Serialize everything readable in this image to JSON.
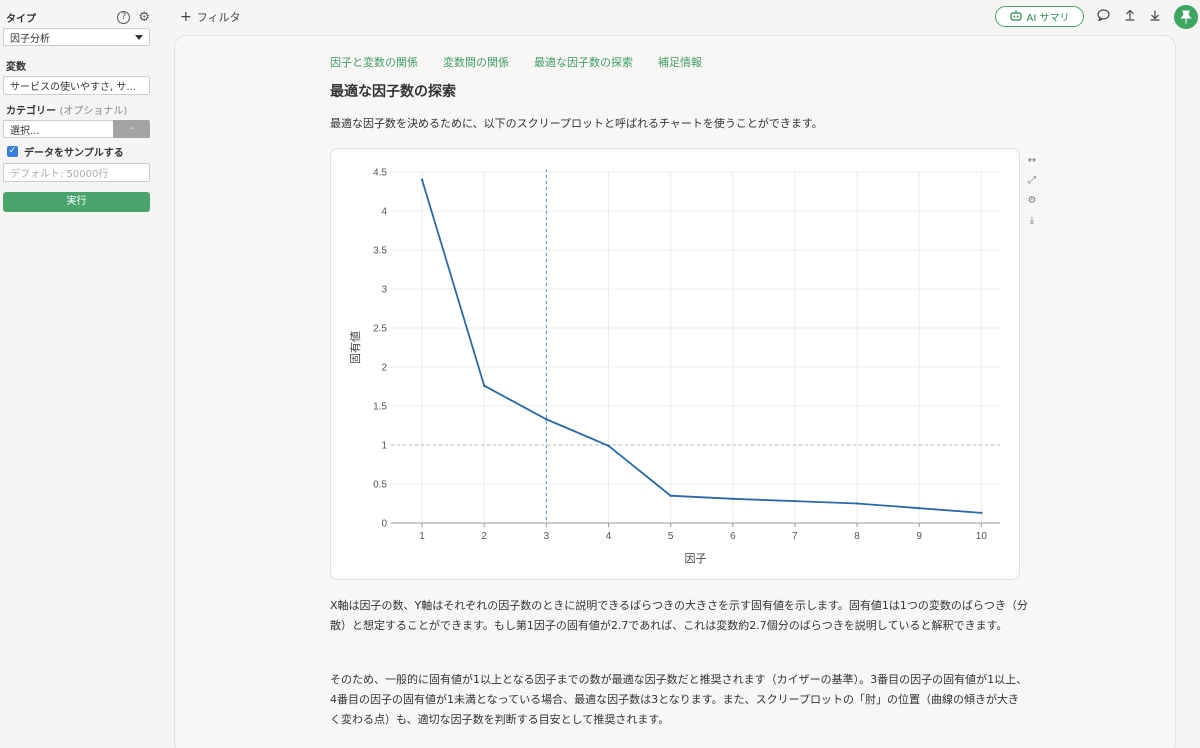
{
  "sidebar": {
    "type_label": "タイプ",
    "type_value": "因子分析",
    "variables_label": "変数",
    "variables_value": "サービスの使いやすさ, サ...",
    "category_label": "カテゴリー",
    "category_optional": "(オプショナル)",
    "category_select": "選択...",
    "category_button": "-",
    "sample_checkbox_label": "データをサンプルする",
    "sample_checked": true,
    "sample_placeholder": "デフォルト: 50000行",
    "run_button": "実行"
  },
  "topbar": {
    "filter_label": "フィルタ",
    "ai_summary_label": "AI サマリ"
  },
  "tabs": [
    "因子と変数の関係",
    "変数間の関係",
    "最適な因子数の探索",
    "補足情報"
  ],
  "section_title": "最適な因子数の探索",
  "intro_text": "最適な因子数を決めるために、以下のスクリープロットと呼ばれるチャートを使うことができます。",
  "paragraphs": [
    "X軸は因子の数、Y軸はそれぞれの因子数のときに説明できるばらつきの大きさを示す固有値を示します。固有値1は1つの変数のばらつき（分散）と想定することができます。もし第1因子の固有値が2.7であれば、これは変数約2.7個分のばらつきを説明していると解釈できます。",
    "そのため、一般的に固有値が1以上となる因子までの数が最適な因子数だと推奨されます（カイザーの基準）。3番目の因子の固有値が1以上、4番目の因子の固有値が1未満となっている場合、最適な因子数は3となります。また、スクリープロットの「肘」の位置（曲線の傾きが大きく変わる点）も、適切な因子数を判断する目安として推奨されます。"
  ],
  "chart_data": {
    "type": "line",
    "xlabel": "因子",
    "ylabel": "固有値",
    "x": [
      1,
      2,
      3,
      4,
      5,
      6,
      7,
      8,
      9,
      10
    ],
    "y": [
      4.4,
      1.76,
      1.33,
      0.99,
      0.35,
      0.31,
      0.28,
      0.25,
      0.19,
      0.13
    ],
    "x_ticks": [
      "1",
      "2",
      "3",
      "4",
      "5",
      "6",
      "7",
      "8",
      "9",
      "10"
    ],
    "y_ticks": [
      "0",
      "0.5",
      "1",
      "1.5",
      "2",
      "2.5",
      "3",
      "3.5",
      "4",
      "4.5"
    ],
    "ylim": [
      0,
      4.5
    ],
    "xlim": [
      0.5,
      10.3
    ],
    "reference_hline": 1,
    "reference_vline": 3,
    "line_color": "#2a69a8",
    "grid": true
  },
  "colors": {
    "accent": "#4ba46b",
    "tab": "#3f9c64",
    "line": "#2a69a8"
  }
}
